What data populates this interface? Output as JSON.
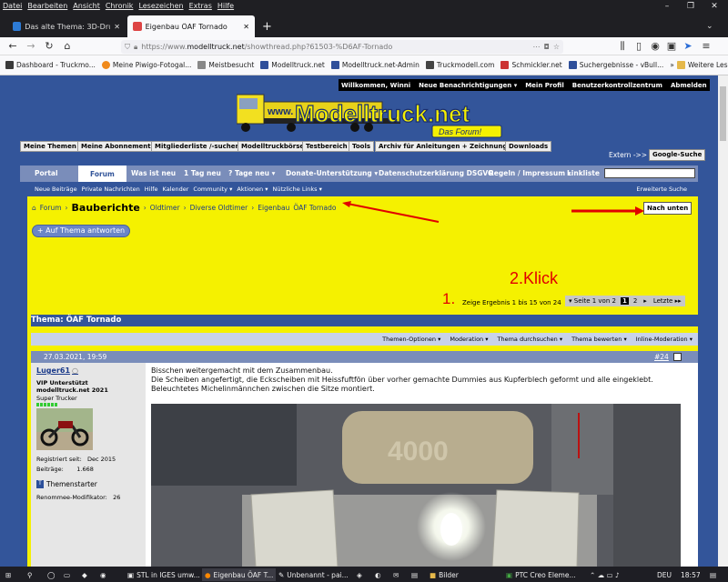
{
  "browser": {
    "menu": [
      "Datei",
      "Bearbeiten",
      "Ansicht",
      "Chronik",
      "Lesezeichen",
      "Extras",
      "Hilfe"
    ],
    "tabs": [
      {
        "label": "Das alte Thema: 3D-Druck - Flu"
      },
      {
        "label": "Eigenbau ÖAF Tornado"
      }
    ],
    "new_tab": "+",
    "url_prefix": "https://www.",
    "url_domain": "modelltruck.net",
    "url_path": "/showthread.php?61503-%D6AF-Tornado",
    "bookmarks": [
      "Dashboard - Truckmo...",
      "Meine Piwigo-Fotogal...",
      "Meistbesucht",
      "Modelltruck.net",
      "Modelltruck.net-Admin",
      "Truckmodell.com",
      "Schmickler.net",
      "Suchergebnisse - vBull...",
      "Weitere Lesezeichen"
    ]
  },
  "forum": {
    "topnav": [
      "Willkommen, Winni",
      "Neue Benachrichtigungen",
      "Mein Profil",
      "Benutzerkontrollzentrum",
      "Abmelden"
    ],
    "logo_text": "Modelltruck.net",
    "logo_www": "www.",
    "logo_sub": "Das Forum!",
    "grey_buttons": [
      "Meine Themen",
      "Meine Abonnements",
      "Mitgliederliste /-suchen",
      "Modelltruckbörse",
      "Testbereich",
      "Tools",
      "Archiv für Anleitungen + Zeichnungen",
      "Downloads"
    ],
    "extern": "Extern ->>",
    "google": "Google-Suche",
    "mainnav": [
      "Portal",
      "Forum",
      "Was ist neu",
      "1 Tag neu",
      "? Tage neu",
      "Donate-Unterstützung",
      "Datenschutzerklärung DSGVO",
      "Regeln / Impressum",
      "Linkliste"
    ],
    "subnav": [
      "Neue Beiträge",
      "Private Nachrichten",
      "Hilfe",
      "Kalender",
      "Community",
      "Aktionen",
      "Nützliche Links"
    ],
    "advanced_search": "Erweiterte Suche",
    "breadcrumb": [
      "Forum",
      "Bauberichte",
      "Oldtimer",
      "Diverse Oldtimer",
      "Eigenbau",
      "ÖAF Tornado"
    ],
    "post_reply": "+ Auf Thema antworten",
    "nach_unten": "Nach unten",
    "results": "Zeige Ergebnis 1 bis 15 von 24",
    "pages": {
      "label": "Seite 1 von 2",
      "current": "1",
      "next": "2",
      "last": "Letzte"
    },
    "thread_title": "Thema: ÖAF Tornado",
    "tools": [
      "Themen-Optionen",
      "Moderation",
      "Thema durchsuchen",
      "Thema bewerten",
      "Inline-Moderation"
    ],
    "annotation1": "1.",
    "annotation2": "2.Klick"
  },
  "post": {
    "date": "27.03.2021, 19:59",
    "number": "#24",
    "user": "Luger61",
    "user_title": "VIP Unterstützt modelltruck.net 2021",
    "rank": "Super Trucker",
    "registered_label": "Registriert seit:",
    "registered": "Dec 2015",
    "posts_label": "Beiträge:",
    "posts": "1.668",
    "starter": "Themenstarter",
    "renommee_label": "Renommee-Modifikator:",
    "renommee": "26",
    "text1": "Bisschen weitergemacht mit dem Zusammenbau.",
    "text2": "Die Scheiben angefertigt, die Eckscheiben mit Heissfuftfön über vorher gemachte Dummies aus Kupferblech geformt und alle eingeklebt.",
    "text3": "Beleuchtetes Michelinmännchen zwischen die Sitze montiert."
  },
  "taskbar": {
    "items": [
      "STL in IGES umw...",
      "Eigenbau ÖAF T...",
      "Unbenannt - pai...",
      "Bilder",
      "PTC Creo Eleme..."
    ],
    "lang": "DEU",
    "time": "18:57"
  },
  "colors": {
    "forum_blue": "#33559a",
    "yellow": "#f5f100",
    "annotation_red": "#e10000"
  }
}
